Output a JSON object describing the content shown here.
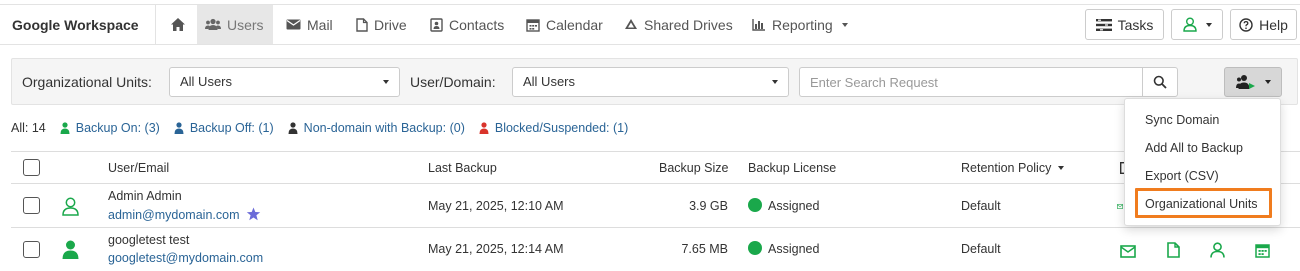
{
  "app": {
    "title": "Google Workspace"
  },
  "nav": {
    "items": [
      {
        "label": "Users",
        "icon": "users-icon"
      },
      {
        "label": "Mail",
        "icon": "envelope-icon"
      },
      {
        "label": "Drive",
        "icon": "file-icon"
      },
      {
        "label": "Contacts",
        "icon": "contact-card-icon"
      },
      {
        "label": "Calendar",
        "icon": "calendar-icon"
      },
      {
        "label": "Shared Drives",
        "icon": "drive-triangle-icon"
      },
      {
        "label": "Reporting",
        "icon": "bar-chart-icon"
      }
    ],
    "active": "Users"
  },
  "toolbar": {
    "tasks_label": "Tasks",
    "help_label": "Help"
  },
  "filters": {
    "ou_label": "Organizational Units:",
    "ou_value": "All Users",
    "domain_label": "User/Domain:",
    "domain_value": "All Users",
    "search_placeholder": "Enter Search Request"
  },
  "summary": {
    "all": "All: 14",
    "backup_on": "Backup On: (3)",
    "backup_off": "Backup Off: (1)",
    "non_domain": "Non-domain with Backup: (0)",
    "blocked": "Blocked/Suspended: (1)"
  },
  "table": {
    "headers": {
      "user": "User/Email",
      "last_backup": "Last Backup",
      "size": "Backup Size",
      "license": "Backup License",
      "retention": "Retention Policy"
    },
    "rows": [
      {
        "name": "Admin Admin",
        "email": "admin@mydomain.com",
        "last_backup": "May 21, 2025, 12:10 AM",
        "size": "3.9 GB",
        "license": "Assigned",
        "retention": "Default",
        "starred": true
      },
      {
        "name": "googletest test",
        "email": "googletest@mydomain.com",
        "last_backup": "May 21, 2025, 12:14 AM",
        "size": "7.65 MB",
        "license": "Assigned",
        "retention": "Default",
        "starred": false
      }
    ]
  },
  "menu": {
    "items": [
      "Sync Domain",
      "Add All to Backup",
      "Export (CSV)",
      "Organizational Units"
    ],
    "highlighted": "Organizational Units"
  },
  "colors": {
    "green": "#1aa84b",
    "blue_link": "#2a6496",
    "dark_user": "#333333",
    "red_user": "#d9342b",
    "highlight": "#f07c1e",
    "star": "#6b6bd8"
  }
}
